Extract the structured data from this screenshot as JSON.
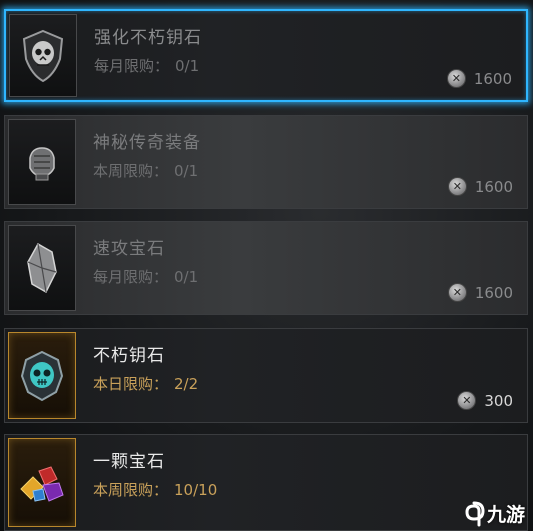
{
  "items": [
    {
      "name": "强化不朽钥石",
      "limit_label": "每月限购：",
      "limit_value": "0/1",
      "price": "1600",
      "state": "selected",
      "icon": "skull-shield-icon"
    },
    {
      "name": "神秘传奇装备",
      "limit_label": "本周限购：",
      "limit_value": "0/1",
      "price": "1600",
      "state": "locked",
      "icon": "gauntlet-icon"
    },
    {
      "name": "速攻宝石",
      "limit_label": "每月限购：",
      "limit_value": "0/1",
      "price": "1600",
      "state": "locked",
      "icon": "crystal-shard-icon"
    },
    {
      "name": "不朽钥石",
      "limit_label": "本日限购：",
      "limit_value": "2/2",
      "price": "300",
      "state": "available",
      "icon": "skull-amulet-icon"
    },
    {
      "name": "一颗宝石",
      "limit_label": "本周限购：",
      "limit_value": "10/10",
      "price": "",
      "state": "available",
      "icon": "gem-cluster-icon"
    }
  ],
  "currency_icon": "silver-coin-icon",
  "watermark": {
    "text": "九游",
    "icon": "nine-game-logo-icon"
  },
  "colors": {
    "selected_border": "#2fb6ff",
    "gold_frame": "#b8872c",
    "limit_text": "#c9a15a"
  }
}
